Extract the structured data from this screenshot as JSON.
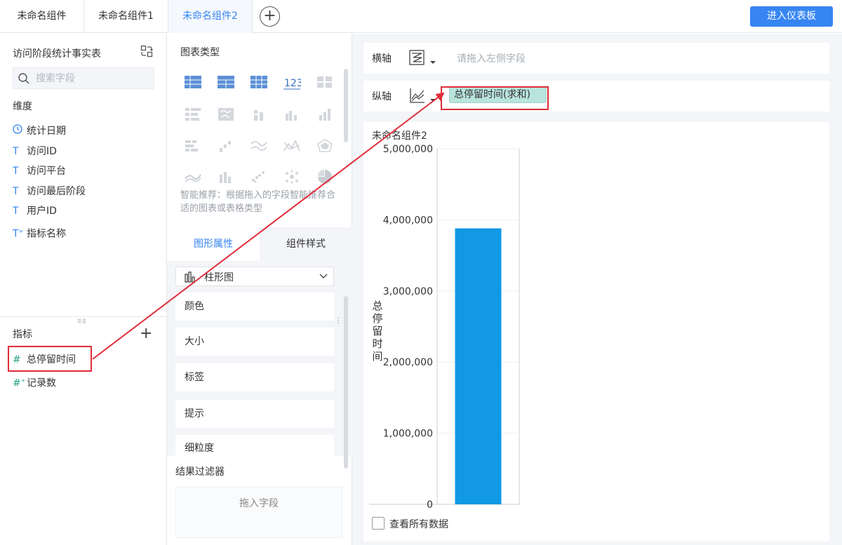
{
  "tabs": [
    {
      "label": "未命名组件",
      "active": false
    },
    {
      "label": "未命名组件1",
      "active": false
    },
    {
      "label": "未命名组件2",
      "active": true
    }
  ],
  "add_tab": "+",
  "enter_dashboard": "进入仪表板",
  "left_panel": {
    "table_name": "访问阶段统计事实表",
    "search_placeholder": "搜索字段",
    "dimension_title": "维度",
    "dimensions": [
      {
        "label": "统计日期",
        "icon": "clock-icon"
      },
      {
        "label": "访问ID",
        "icon": "text-type-icon"
      },
      {
        "label": "访问平台",
        "icon": "text-type-icon"
      },
      {
        "label": "访问最后阶段",
        "icon": "text-type-icon"
      },
      {
        "label": "用户ID",
        "icon": "text-type-icon"
      },
      {
        "label": "指标名称",
        "icon": "text-calc-type-icon"
      }
    ],
    "measure_title": "指标",
    "measures": [
      {
        "label": "总停留时间",
        "icon": "number-type-icon"
      },
      {
        "label": "记录数",
        "icon": "number-calc-type-icon"
      }
    ]
  },
  "mid_panel": {
    "chart_type_title": "图表类型",
    "hint": "智能推荐：根据拖入的字段智能推荐合适的图表或表格类型",
    "prop_tabs": [
      "图形属性",
      "组件样式"
    ],
    "chart_select": "柱形图",
    "props": [
      "颜色",
      "大小",
      "标签",
      "提示",
      "细粒度"
    ],
    "filter_title": "结果过滤器",
    "filter_placeholder": "拖入字段"
  },
  "axes": {
    "x_label": "横轴",
    "x_placeholder": "请拖入左侧字段",
    "y_label": "纵轴",
    "y_field": "总停留时间(求和)"
  },
  "chart_data": {
    "type": "bar",
    "title": "未命名组件2",
    "ylabel": "总停留时间",
    "xlabel": "",
    "categories": [
      ""
    ],
    "values": [
      3880000
    ],
    "ylim": [
      0,
      5000000
    ],
    "yticks": [
      "0",
      "1,000,000",
      "2,000,000",
      "3,000,000",
      "4,000,000",
      "5,000,000"
    ],
    "grid": true,
    "color": "#1199e5"
  },
  "show_all_data": "查看所有数据",
  "colors": {
    "accent": "#3685f2",
    "highlight": "#e02c3a",
    "bar": "#1199e5"
  }
}
